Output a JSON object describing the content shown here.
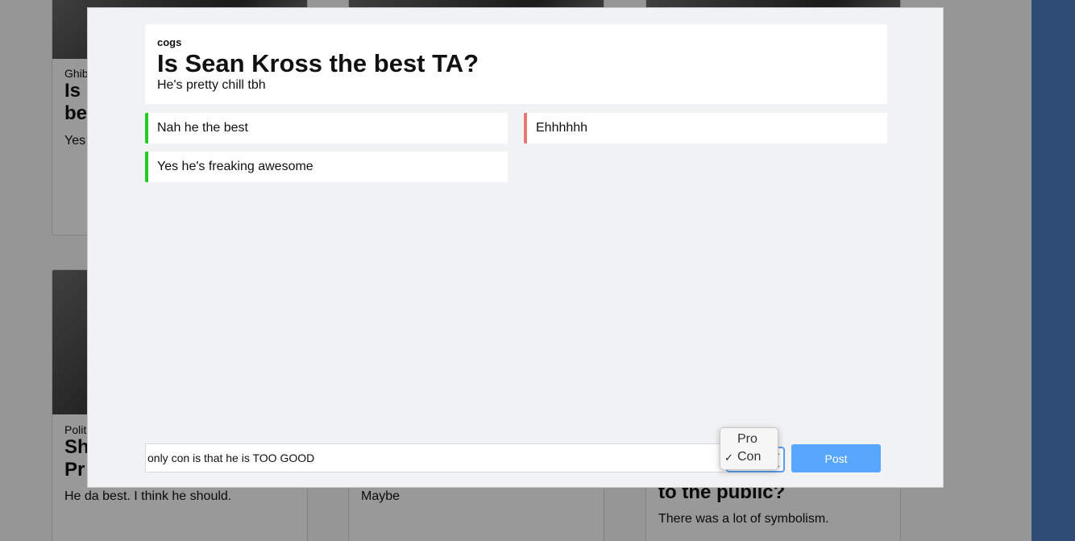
{
  "background": {
    "cards": [
      {
        "category": "Ghib",
        "title": "Is\nbe",
        "subtitle": "Yes"
      },
      {
        "category": "Polit",
        "title": "Sh\nPr",
        "subtitle": "He da best. I think he should."
      },
      {
        "subtitle": "Maybe"
      },
      {
        "title": "to the public?",
        "subtitle": "There was a lot of symbolism."
      }
    ]
  },
  "modal": {
    "category": "cogs",
    "question": "Is Sean Kross the best TA?",
    "description": "He's pretty chill tbh",
    "pro_arguments": [
      "Nah he the best",
      "Yes he's freaking awesome"
    ],
    "con_arguments": [
      "Ehhhhhh"
    ],
    "composer": {
      "input_value": "only con is that he is TOO GOOD",
      "select_options": [
        "Pro",
        "Con"
      ],
      "selected_option": "Con",
      "checkmark": "✓",
      "arrows": "⌃⌄",
      "post_label": "Post"
    }
  },
  "colors": {
    "pro_border": "#22cc22",
    "con_border": "#e57873",
    "post_button": "#57a6ff",
    "right_bar": "#4f7fc5"
  }
}
